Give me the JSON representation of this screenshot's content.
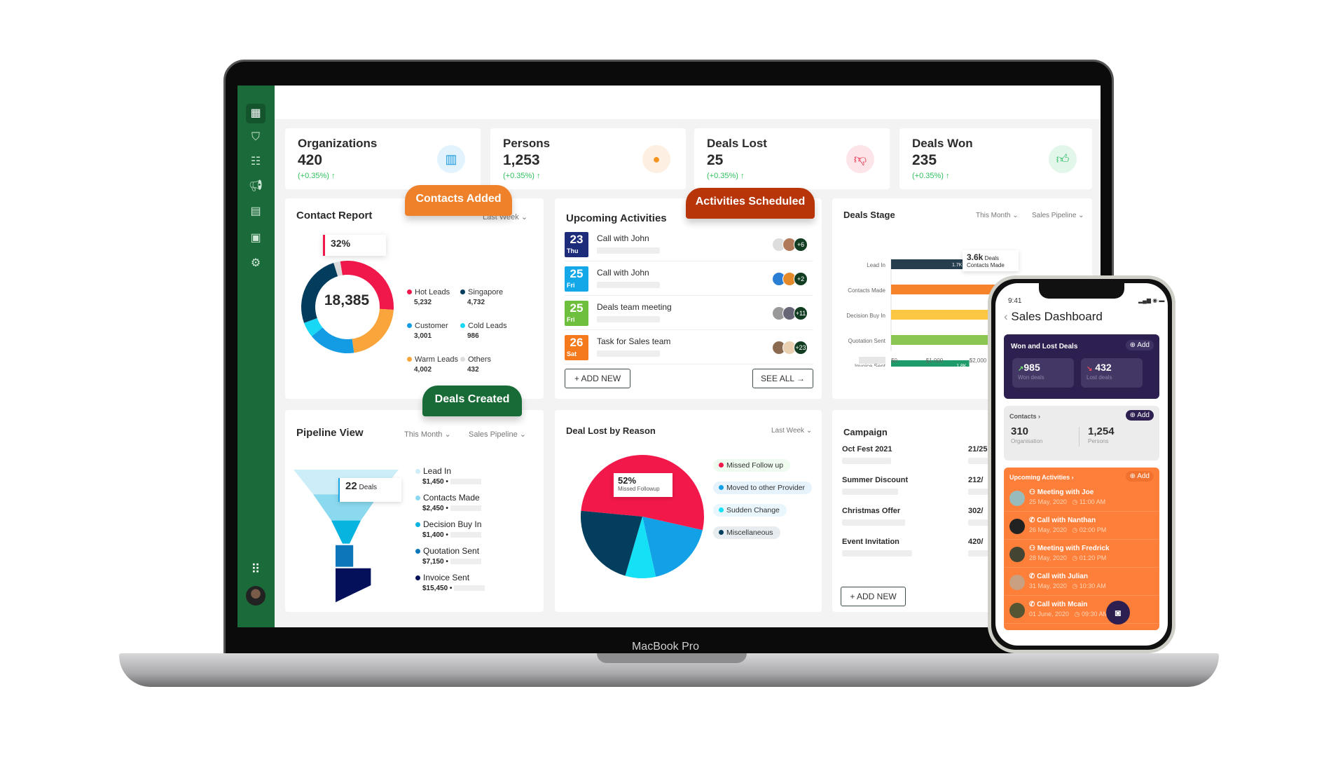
{
  "brand": "MacBook Pro",
  "sidebar": {
    "items": [
      "dashboard-icon",
      "deals-icon",
      "contacts-icon",
      "campaign-icon",
      "documents-icon",
      "calendar-icon",
      "settings-icon"
    ],
    "apps_icon": "grid-icon",
    "avatar": "user-avatar"
  },
  "kpis": [
    {
      "title": "Organizations",
      "value": "420",
      "delta": "(+0.35%) ↑",
      "icon": "building-icon",
      "color": "#1e9be0",
      "bg": "#e3f3fd"
    },
    {
      "title": "Persons",
      "value": "1,253",
      "delta": "(+0.35%) ↑",
      "icon": "person-icon",
      "color": "#f5931f",
      "bg": "#fdf0e2"
    },
    {
      "title": "Deals Lost",
      "value": "25",
      "delta": "(+0.35%) ↑",
      "icon": "thumbs-down-icon",
      "color": "#e8203c",
      "bg": "#fde4e8"
    },
    {
      "title": "Deals Won",
      "value": "235",
      "delta": "(+0.35%) ↑",
      "icon": "thumbs-up-icon",
      "color": "#22b95a",
      "bg": "#e2f7ea"
    }
  ],
  "badges": {
    "contacts_added": "Contacts Added",
    "activities_scheduled": "Activities Scheduled",
    "deals_created": "Deals Created"
  },
  "contact_report": {
    "title": "Contact Report",
    "filter": "Last Week",
    "tooltip": "32%",
    "total": "18,385",
    "segments": [
      {
        "label": "Hot Leads",
        "value": "5,232",
        "n": 5232,
        "color": "#f0184a"
      },
      {
        "label": "Warm Leads",
        "value": "4,002",
        "n": 4002,
        "color": "#f9a53b"
      },
      {
        "label": "Customer",
        "value": "3,001",
        "n": 3001,
        "color": "#139be3"
      },
      {
        "label": "Cold Leads",
        "value": "986",
        "n": 986,
        "color": "#19d8f5"
      },
      {
        "label": "Singapore",
        "value": "4,732",
        "n": 4732,
        "color": "#033d5e"
      },
      {
        "label": "Others",
        "value": "432",
        "n": 432,
        "color": "#dcdcdc"
      }
    ]
  },
  "activities": {
    "title": "Upcoming Activities",
    "items": [
      {
        "day": "23",
        "wd": "Thu",
        "name": "Call with John",
        "color": "#1c2c7a",
        "more": "+6"
      },
      {
        "day": "25",
        "wd": "Fri",
        "name": "Call with John",
        "color": "#15a8e8",
        "more": "+2"
      },
      {
        "day": "25",
        "wd": "Fri",
        "name": "Deals team meeting",
        "color": "#6fbf3f",
        "more": "+11"
      },
      {
        "day": "26",
        "wd": "Sat",
        "name": "Task for Sales team",
        "color": "#f47a1c",
        "more": "+23"
      }
    ],
    "add": "+ ADD NEW",
    "see_all": "SEE ALL →"
  },
  "deals_stage": {
    "title": "Deals Stage",
    "filter1": "This Month",
    "filter2": "Sales Pipeline",
    "tooltip_value": "3.6k",
    "tooltip_unit": "Deals",
    "tooltip_label": "Contacts Made"
  },
  "chart_data": [
    {
      "type": "bar",
      "orientation": "horizontal",
      "categories": [
        "Lead In",
        "Contacts Made",
        "Decision Buy In",
        "Quotation Sent",
        "Invoice Sent"
      ],
      "values": [
        1700,
        3600,
        null,
        2700,
        1800
      ],
      "data_labels": [
        "1.7K",
        "3.6K",
        "",
        "2.7K",
        "1.8K"
      ],
      "colors": [
        "#263f4f",
        "#f6822a",
        "#fcc844",
        "#8cc652",
        "#1f9a6a"
      ],
      "xticks": [
        "$0",
        "$1,000",
        "$2,000"
      ]
    },
    {
      "type": "pie",
      "categories": [
        "Missed Follow up",
        "Moved to other Provider",
        "Sudden Change",
        "Miscellaneous"
      ],
      "values": [
        52,
        18,
        8,
        22
      ],
      "colors": [
        "#f2184a",
        "#12a1e6",
        "#14e1f5",
        "#033e5e"
      ],
      "annotation": {
        "value": "52%",
        "label": "Missed Followup"
      }
    }
  ],
  "pipeline": {
    "title": "Pipeline View",
    "filter1": "This Month",
    "filter2": "Sales Pipeline",
    "tooltip_value": "22",
    "tooltip_unit": "Deals",
    "stages": [
      {
        "label": "Lead In",
        "value": "$1,450",
        "color": "#cdeef8"
      },
      {
        "label": "Contacts Made",
        "value": "$2,450",
        "color": "#8ad9ef"
      },
      {
        "label": "Decision Buy In",
        "value": "$1,400",
        "color": "#07b4e0"
      },
      {
        "label": "Quotation Sent",
        "value": "$7,150",
        "color": "#0b77ba"
      },
      {
        "label": "Invoice Sent",
        "value": "$15,450",
        "color": "#05105a"
      }
    ]
  },
  "deal_lost": {
    "title": "Deal Lost by Reason",
    "filter": "Last Week",
    "legend_bg": [
      "#eefbee",
      "#e6f3fd",
      "#e9f7fd",
      "#e6ecef"
    ]
  },
  "campaign": {
    "title": "Campaign",
    "items": [
      {
        "name": "Oct Fest 2021",
        "value": "21/25"
      },
      {
        "name": "Summer Discount",
        "value": "212/"
      },
      {
        "name": "Christmas Offer",
        "value": "302/"
      },
      {
        "name": "Event Invitation",
        "value": "420/"
      }
    ],
    "add": "+ ADD NEW"
  },
  "phone": {
    "time": "9:41",
    "title": "Sales Dashboard",
    "won_lost": {
      "title": "Won and Lost Deals",
      "add": "Add",
      "won": "985",
      "won_label": "Won deals",
      "lost": "432",
      "lost_label": "Lost deals"
    },
    "contacts": {
      "title": "Contacts ›",
      "add": "Add",
      "org": "310",
      "org_label": "Organisation",
      "persons": "1,254",
      "persons_label": "Persons"
    },
    "upcoming": {
      "title": "Upcoming Activities ›",
      "add": "Add",
      "items": [
        {
          "name": "Meeting with Joe",
          "date": "25 May, 2020",
          "time": "11:00 AM",
          "type": "meeting"
        },
        {
          "name": "Call with Nanthan",
          "date": "26 May, 2020",
          "time": "02:00 PM",
          "type": "call"
        },
        {
          "name": "Meeting with Fredrick",
          "date": "28 May, 2020",
          "time": "01:20 PM",
          "type": "meeting"
        },
        {
          "name": "Call with Julian",
          "date": "31 May, 2020",
          "time": "10:30 AM",
          "type": "call"
        },
        {
          "name": "Call with Mcain",
          "date": "01 June, 2020",
          "time": "09:30 AM",
          "type": "call"
        }
      ]
    },
    "fab_icon": "camera-icon"
  }
}
